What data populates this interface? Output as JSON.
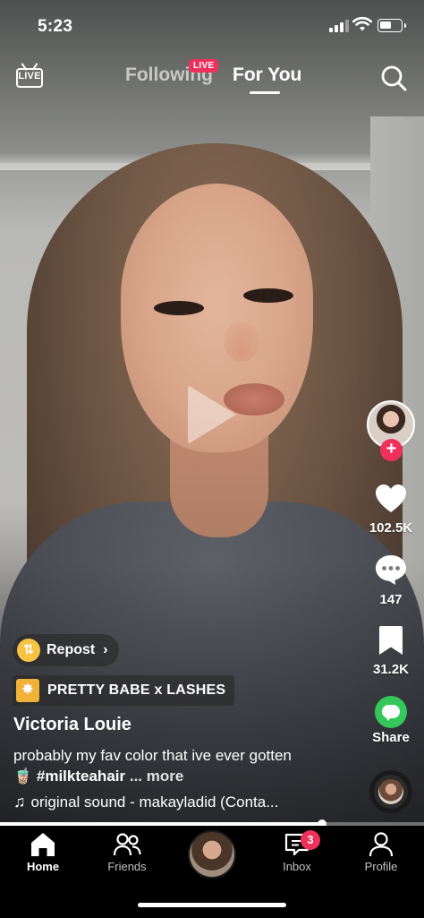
{
  "status_bar": {
    "time": "5:23",
    "battery_level": 0.55,
    "signal_bars": 3
  },
  "top_nav": {
    "live_icon_label": "LIVE",
    "tabs": [
      {
        "label": "Following",
        "active": false
      },
      {
        "label": "For You",
        "active": true
      }
    ],
    "live_badge": "LIVE",
    "search_icon": "search-icon"
  },
  "video": {
    "paused": true,
    "progress": 0.76
  },
  "right_rail": {
    "likes": "102.5K",
    "comments": "147",
    "favorites": "31.2K",
    "share_label": "Share",
    "follow_icon": "plus-icon"
  },
  "caption": {
    "repost_label": "Repost",
    "effect_label": "PRETTY BABE x LASHES",
    "username": "Victoria Louie",
    "text_before": "probably my fav color that ive ever gotten 🧋 ",
    "hashtag": "#milkteahair",
    "more": " ... more",
    "sound": "original sound - makayladid (Conta..."
  },
  "tab_bar": {
    "items": [
      {
        "label": "Home",
        "icon": "home-icon",
        "active": true
      },
      {
        "label": "Friends",
        "icon": "friends-icon",
        "active": false
      },
      {
        "label": "Inbox",
        "icon": "inbox-icon",
        "active": false
      },
      {
        "label": "Profile",
        "icon": "profile-icon",
        "active": false
      }
    ],
    "inbox_badge": "3"
  },
  "colors": {
    "accent_pink": "#f0305c",
    "share_green": "#34c759",
    "repost_yellow": "#f6c343"
  }
}
